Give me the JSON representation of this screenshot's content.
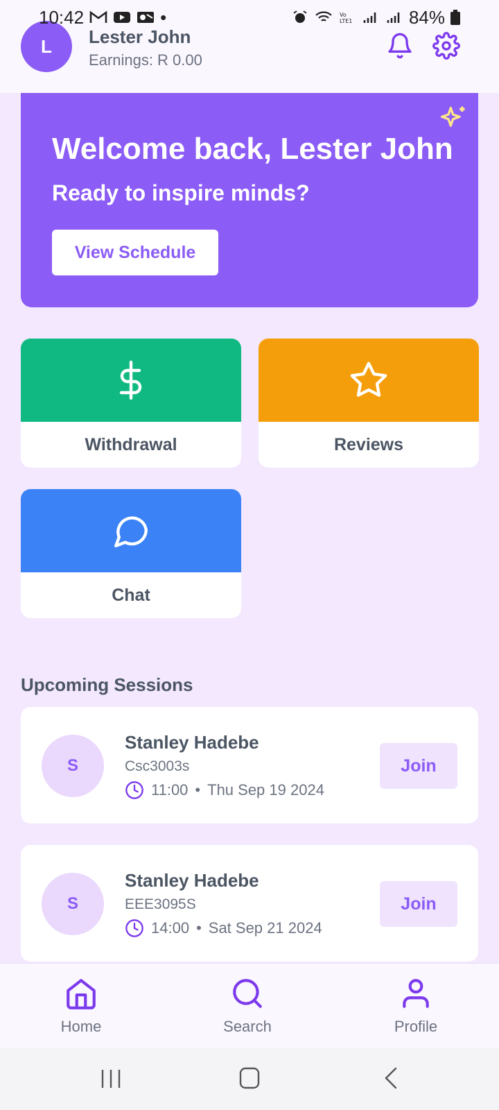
{
  "status_bar": {
    "time": "10:42",
    "dot": "•",
    "battery": "84%"
  },
  "header": {
    "avatar_initial": "L",
    "user_name": "Lester John",
    "earnings": "Earnings: R 0.00"
  },
  "welcome": {
    "title": "Welcome back, Lester John",
    "subtitle": "Ready to inspire minds?",
    "button_label": "View Schedule"
  },
  "actions": [
    {
      "label": "Withdrawal",
      "icon": "dollar-icon",
      "color": "#10b981"
    },
    {
      "label": "Reviews",
      "icon": "star-icon",
      "color": "#f59e0b"
    },
    {
      "label": "Chat",
      "icon": "chat-bubble-icon",
      "color": "#3b82f6"
    }
  ],
  "sessions": {
    "title": "Upcoming Sessions",
    "items": [
      {
        "initial": "S",
        "name": "Stanley Hadebe",
        "course": "Csc3003s",
        "time": "11:00",
        "separator": "•",
        "date": "Thu Sep 19 2024",
        "button": "Join"
      },
      {
        "initial": "S",
        "name": "Stanley Hadebe",
        "course": "EEE3095S",
        "time": "14:00",
        "separator": "•",
        "date": "Sat Sep 21 2024",
        "button": "Join"
      }
    ]
  },
  "nav": [
    {
      "label": "Home",
      "icon": "home-icon"
    },
    {
      "label": "Search",
      "icon": "search-icon"
    },
    {
      "label": "Profile",
      "icon": "profile-icon"
    }
  ],
  "colors": {
    "primary": "#8b5cf6",
    "background": "#f3e8fd",
    "withdrawal": "#10b981",
    "reviews": "#f59e0b",
    "chat": "#3b82f6"
  }
}
